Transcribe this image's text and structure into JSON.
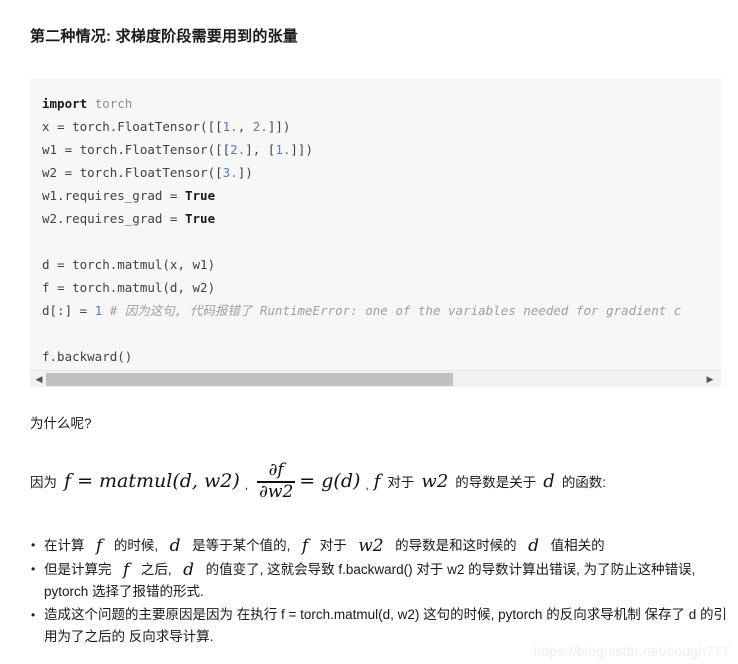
{
  "section": {
    "title": "第二种情况: 求梯度阶段需要用到的张量"
  },
  "code_block": {
    "language": "python",
    "lines": [
      [
        {
          "t": "import",
          "c": "kw"
        },
        {
          "t": " ",
          "c": "plain"
        },
        {
          "t": "torch",
          "c": "bi"
        }
      ],
      [
        {
          "t": "x = torch.FloatTensor([[",
          "c": "plain"
        },
        {
          "t": "1.",
          "c": "num"
        },
        {
          "t": ", ",
          "c": "plain"
        },
        {
          "t": "2.",
          "c": "num"
        },
        {
          "t": "]])",
          "c": "plain"
        }
      ],
      [
        {
          "t": "w1 = torch.FloatTensor([[",
          "c": "plain"
        },
        {
          "t": "2.",
          "c": "num"
        },
        {
          "t": "], [",
          "c": "plain"
        },
        {
          "t": "1.",
          "c": "num"
        },
        {
          "t": "]])",
          "c": "plain"
        }
      ],
      [
        {
          "t": "w2 = torch.FloatTensor([",
          "c": "plain"
        },
        {
          "t": "3.",
          "c": "num"
        },
        {
          "t": "])",
          "c": "plain"
        }
      ],
      [
        {
          "t": "w1.requires_grad = ",
          "c": "plain"
        },
        {
          "t": "True",
          "c": "bool"
        }
      ],
      [
        {
          "t": "w2.requires_grad = ",
          "c": "plain"
        },
        {
          "t": "True",
          "c": "bool"
        }
      ],
      [],
      [
        {
          "t": "d = torch.matmul(x, w1)",
          "c": "plain"
        }
      ],
      [
        {
          "t": "f = torch.matmul(d, w2)",
          "c": "plain"
        }
      ],
      [
        {
          "t": "d[:] = ",
          "c": "plain"
        },
        {
          "t": "1",
          "c": "num"
        },
        {
          "t": " # 因为这句, 代码报错了 RuntimeError: one of the variables needed for gradient c",
          "c": "cmt"
        }
      ],
      [],
      [
        {
          "t": "f.backward()",
          "c": "plain"
        }
      ]
    ],
    "scrollbar": {
      "left_arrow": "◀",
      "right_arrow": "▶",
      "thumb_percent": 62
    }
  },
  "body": {
    "question": "为什么呢?",
    "formula": {
      "prefix_cn": "因为",
      "expr1": "f = matmul(d, w2)",
      "separator1": ",",
      "frac_numerator": "∂f",
      "frac_denominator": "∂w2",
      "equals_rhs": "= g(d)",
      "separator2": ",",
      "var_f": "f",
      "mid_cn1": "对于",
      "var_w2": "w2",
      "mid_cn2": "的导数是关于",
      "var_d": "d",
      "suffix_cn": "的函数:"
    },
    "bullets": [
      {
        "p1": "在计算",
        "m1": "f",
        "p2": "的时候,",
        "m2": "d",
        "p3": "是等于某个值的,",
        "m3": "f",
        "p4": "对于",
        "m4": "w2",
        "p5": "的导数是和这时候的",
        "m5": "d",
        "p6": "值相关的"
      },
      {
        "p1": "但是计算完",
        "m1": "f",
        "p2": "之后,",
        "m2": "d",
        "p3": "的值变了, 这就会导致 f.backward() 对于 w2 的导数计算出错误, 为了防止这种错误, pytorch 选择了报错的形式."
      },
      {
        "p1": "造成这个问题的主要原因是因为 在执行 f = torch.matmul(d, w2) 这句的时候, pytorch 的反向求导机制 保存了 d 的引用为了之后的 反向求导计算."
      }
    ]
  },
  "watermark": {
    "text": "https://blog.csdn.net/cough777"
  },
  "colors": {
    "code_background": "#f7f7f8",
    "keyword": "#1a1a1a",
    "builtin": "#8b8f96",
    "number": "#4f7fd4",
    "comment": "#9aa0a6",
    "scrollbar_track": "#f1f1f1",
    "scrollbar_thumb": "#c0c0c0",
    "watermark": "#eeeeee"
  }
}
